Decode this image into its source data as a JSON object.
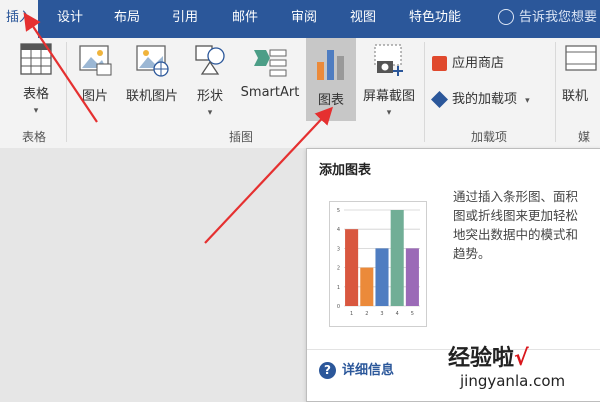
{
  "tabs": [
    {
      "label": "插入",
      "active": true
    },
    {
      "label": "设计"
    },
    {
      "label": "布局"
    },
    {
      "label": "引用"
    },
    {
      "label": "邮件"
    },
    {
      "label": "审阅"
    },
    {
      "label": "视图"
    },
    {
      "label": "特色功能"
    }
  ],
  "tell_me": "告诉我您想要",
  "ribbon": {
    "table": {
      "label": "表格",
      "group": "表格"
    },
    "illustrations": {
      "group": "插图",
      "items": [
        "图片",
        "联机图片",
        "形状",
        "SmartArt",
        "图表",
        "屏幕截图"
      ]
    },
    "addins": {
      "group": "加载项",
      "store": "应用商店",
      "my_addins": "我的加载项"
    },
    "media": {
      "label": "联机",
      "group": "媒"
    }
  },
  "tooltip": {
    "title": "添加图表",
    "description": "通过插入条形图、面积图或折线图来更加轻松地突出数据中的模式和趋势。",
    "desc_lines": [
      "通过插入条形图、面积",
      "图或折线图来更加轻松",
      "地突出数据中的模式和",
      "趋势。"
    ],
    "more": "详细信息"
  },
  "chart_data": {
    "type": "bar",
    "categories": [
      "1",
      "2",
      "3",
      "4",
      "5"
    ],
    "values": [
      4,
      2,
      3,
      5,
      3
    ],
    "ylim": [
      0,
      5
    ],
    "yticks": [
      "0",
      "1",
      "2",
      "3",
      "4",
      "5"
    ],
    "colors": [
      "#d9573f",
      "#eb8a3a",
      "#4f7dc1",
      "#71ae96",
      "#9b6ab7"
    ],
    "grid": true
  },
  "watermark": {
    "main": "经验啦",
    "check": "√",
    "sub": "jingyanla.com"
  },
  "colors": {
    "accent": "#2b579a",
    "arrow": "#e53030"
  }
}
